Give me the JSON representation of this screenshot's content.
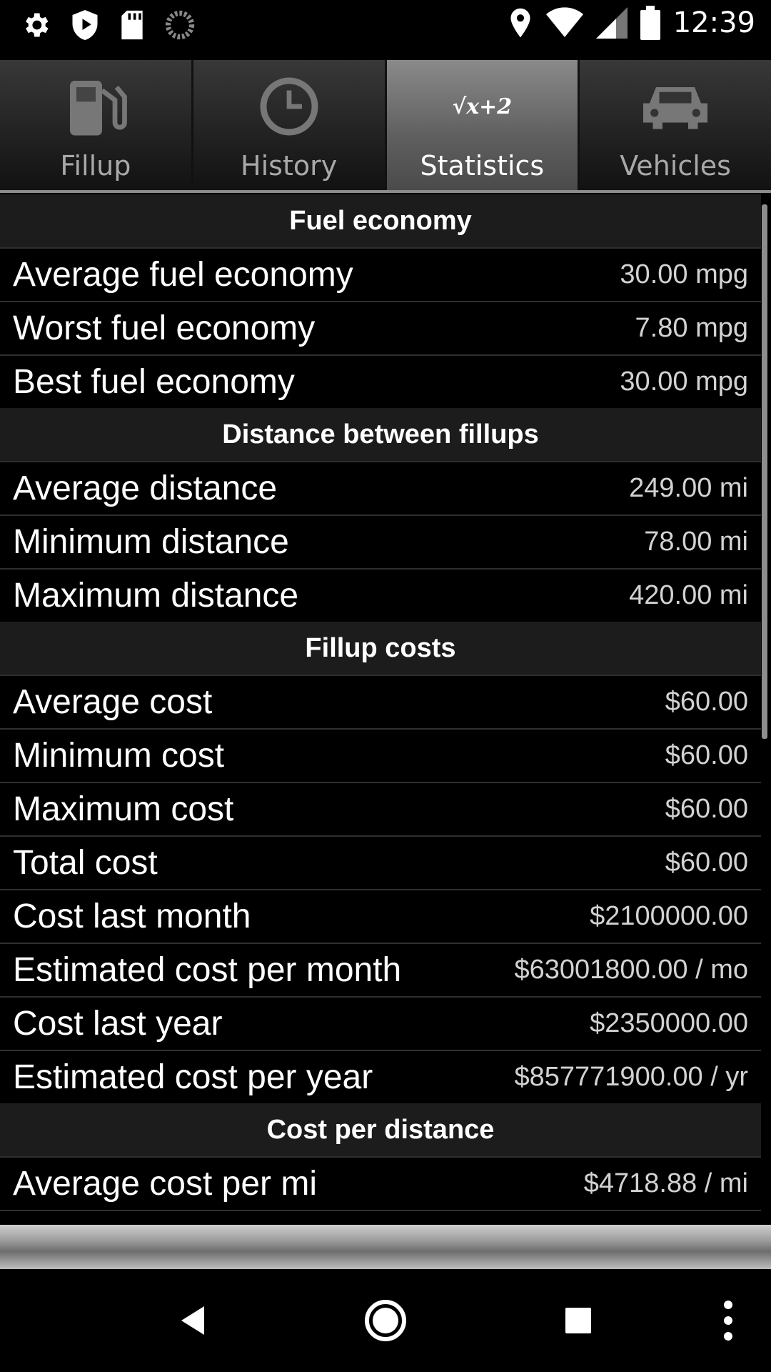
{
  "status_bar": {
    "time": "12:39",
    "left_icons": [
      "settings-icon",
      "play-shield-icon",
      "sd-card-icon",
      "loading-icon"
    ],
    "right_icons": [
      "location-icon",
      "wifi-icon",
      "signal-icon",
      "battery-icon"
    ]
  },
  "tabs": [
    {
      "label": "Fillup",
      "icon": "fuel-pump-icon",
      "active": false
    },
    {
      "label": "History",
      "icon": "clock-icon",
      "active": false
    },
    {
      "label": "Statistics",
      "icon": "sqrt-icon",
      "icon_text": "√x+2",
      "active": true
    },
    {
      "label": "Vehicles",
      "icon": "car-icon",
      "active": false
    }
  ],
  "sections": [
    {
      "title": "Fuel economy",
      "rows": [
        {
          "label": "Average fuel economy",
          "value": "30.00 mpg"
        },
        {
          "label": "Worst fuel economy",
          "value": "7.80 mpg"
        },
        {
          "label": "Best fuel economy",
          "value": "30.00 mpg"
        }
      ]
    },
    {
      "title": "Distance between fillups",
      "rows": [
        {
          "label": "Average distance",
          "value": "249.00 mi"
        },
        {
          "label": "Minimum distance",
          "value": "78.00 mi"
        },
        {
          "label": "Maximum distance",
          "value": "420.00 mi"
        }
      ]
    },
    {
      "title": "Fillup costs",
      "rows": [
        {
          "label": "Average cost",
          "value": "$60.00"
        },
        {
          "label": "Minimum cost",
          "value": "$60.00"
        },
        {
          "label": "Maximum cost",
          "value": "$60.00"
        },
        {
          "label": "Total cost",
          "value": "$60.00"
        },
        {
          "label": "Cost last month",
          "value": "$2100000.00"
        },
        {
          "label": "Estimated cost per month",
          "value": "$63001800.00 / mo"
        },
        {
          "label": "Cost last year",
          "value": "$2350000.00"
        },
        {
          "label": "Estimated cost per year",
          "value": "$857771900.00 / yr"
        }
      ]
    },
    {
      "title": "Cost per distance",
      "rows": [
        {
          "label": "Average cost per mi",
          "value": "$4718.88 / mi"
        }
      ]
    }
  ],
  "nav_bar": {
    "buttons": [
      "back-icon",
      "home-icon",
      "recents-icon",
      "overflow-menu-icon"
    ]
  },
  "colors": {
    "background": "#000000",
    "section_header": "#1c1c1c",
    "active_tab": "#6e6e6e"
  }
}
